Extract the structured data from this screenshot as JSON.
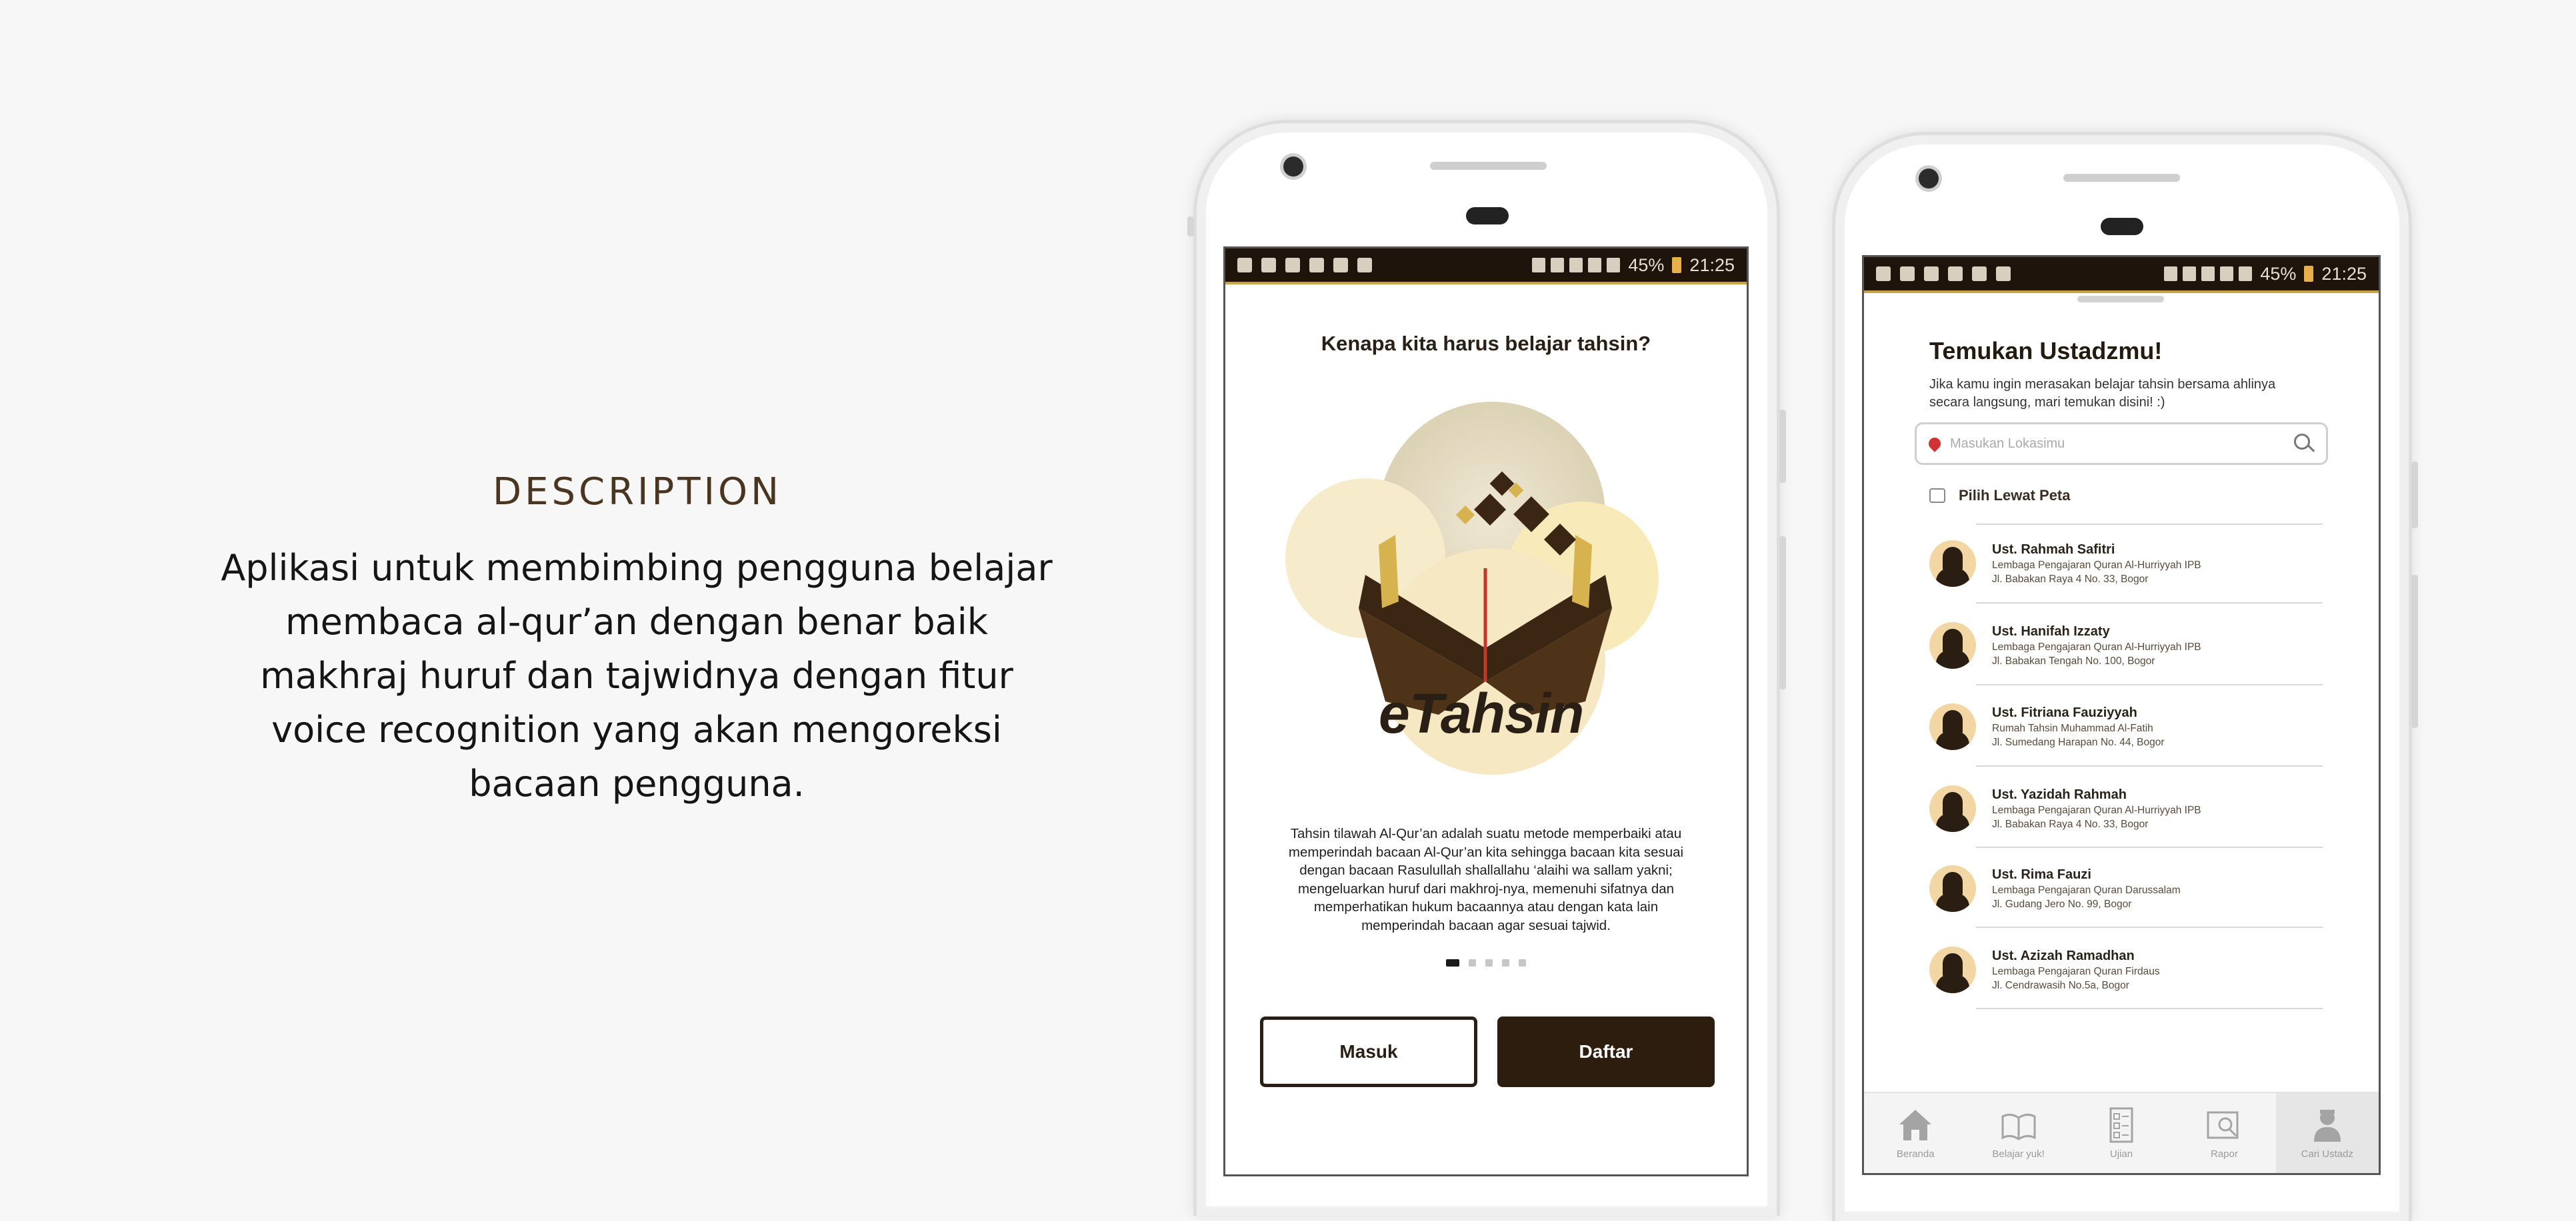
{
  "description": {
    "heading": "DESCRIPTION",
    "body": "Aplikasi untuk membimbing pengguna belajar membaca al-qur’an dengan benar baik makhraj huruf dan tajwidnya dengan fitur voice recognition yang akan mengoreksi bacaan pengguna."
  },
  "status_bar": {
    "battery": "45%",
    "time": "21:25"
  },
  "onboarding": {
    "title": "Kenapa kita harus belajar tahsin?",
    "logo_text": "eTahsin",
    "paragraph": "Tahsin tilawah Al-Qur’an adalah suatu metode  memperbaiki atau memperindah bacaan Al-Qur’an kita sehingga bacaan kita sesuai dengan bacaan Rasulullah shallallahu ‘alaihi wa sallam yakni; mengeluarkan huruf dari makhroj-nya, memenuhi sifatnya dan memperhatikan hukum bacaannya atau dengan kata lain memperindah bacaan agar sesuai tajwid.",
    "page_count": 5,
    "active_page": 1,
    "login_label": "Masuk",
    "register_label": "Daftar"
  },
  "find_teacher": {
    "title": "Temukan Ustadzmu!",
    "subtitle": "Jika kamu ingin merasakan belajar tahsin bersama ahlinya secara langsung, mari temukan disini! :)",
    "search_placeholder": "Masukan Lokasimu",
    "map_option": "Pilih Lewat Peta",
    "teachers": [
      {
        "name": "Ust. Rahmah Safitri",
        "institution": "Lembaga Pengajaran Quran Al-Hurriyyah IPB",
        "address": "Jl. Babakan Raya 4 No. 33, Bogor"
      },
      {
        "name": "Ust. Hanifah Izzaty",
        "institution": "Lembaga Pengajaran Quran Al-Hurriyyah IPB",
        "address": "Jl. Babakan Tengah No. 100, Bogor"
      },
      {
        "name": "Ust. Fitriana Fauziyyah",
        "institution": "Rumah Tahsin Muhammad Al-Fatih",
        "address": "Jl. Sumedang Harapan No. 44, Bogor"
      },
      {
        "name": "Ust. Yazidah Rahmah",
        "institution": "Lembaga Pengajaran Quran Al-Hurriyyah IPB",
        "address": "Jl. Babakan Raya 4 No. 33, Bogor"
      },
      {
        "name": "Ust. Rima Fauzi",
        "institution": "Lembaga Pengajaran Quran Darussalam",
        "address": "Jl. Gudang Jero No. 99, Bogor"
      },
      {
        "name": "Ust. Azizah Ramadhan",
        "institution": "Lembaga Pengajaran Quran Firdaus",
        "address": "Jl. Cendrawasih No.5a, Bogor"
      }
    ],
    "nav": [
      {
        "label": "Beranda",
        "icon": "home-icon"
      },
      {
        "label": "Belajar yuk!",
        "icon": "book-icon"
      },
      {
        "label": "Ujian",
        "icon": "checklist-icon"
      },
      {
        "label": "Rapor",
        "icon": "report-icon"
      },
      {
        "label": "Cari Ustadz",
        "icon": "teacher-icon"
      }
    ],
    "active_nav": "Cari Ustadz"
  }
}
